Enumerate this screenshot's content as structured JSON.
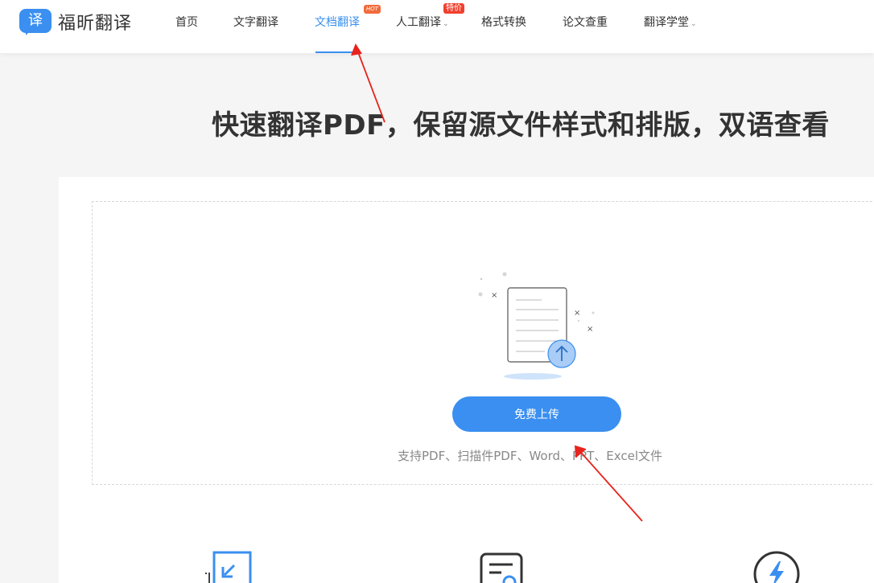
{
  "brand": {
    "logo_char": "译",
    "name": "福昕翻译"
  },
  "nav": {
    "items": [
      {
        "label": "首页"
      },
      {
        "label": "文字翻译"
      },
      {
        "label": "文档翻译",
        "badge": "HOT"
      },
      {
        "label": "人工翻译",
        "badge": "特价",
        "dropdown": "⌄"
      },
      {
        "label": "格式转换"
      },
      {
        "label": "论文查重"
      },
      {
        "label": "翻译学堂",
        "dropdown": "⌄"
      }
    ],
    "active_index": 2
  },
  "hero": {
    "headline": "快速翻译PDF，保留源文件样式和排版，双语查看"
  },
  "upload": {
    "button_label": "免费上传",
    "support_text": "支持PDF、扫描件PDF、Word、PPT、Excel文件"
  },
  "features": [
    {
      "icon": "import-arrow-icon"
    },
    {
      "icon": "document-search-icon"
    },
    {
      "icon": "lightning-bolt-icon"
    }
  ],
  "colors": {
    "accent": "#3a8ff0",
    "hot_badge": "#f26a3a",
    "sale_badge": "#f0402e",
    "annotation_arrow": "#e8231c"
  }
}
